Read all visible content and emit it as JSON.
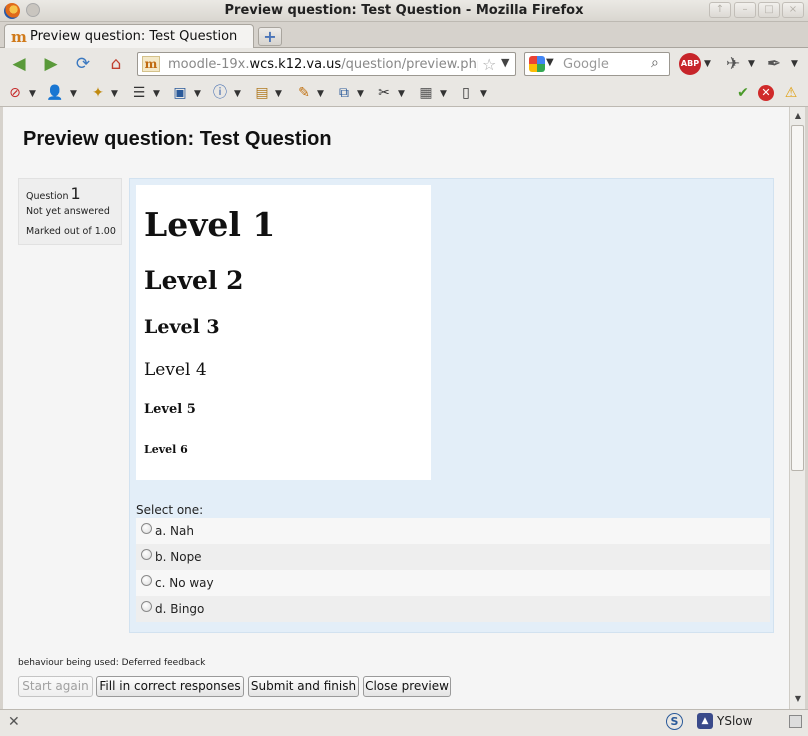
{
  "window": {
    "title": "Preview question: Test Question - Mozilla Firefox",
    "controls": [
      "↑",
      "–",
      "□",
      "×"
    ]
  },
  "tab": {
    "title": "Preview question: Test Question",
    "new_tab": "+"
  },
  "nav": {
    "url_prefix": "moodle-19x.",
    "url_host": "wcs.k12.va.us",
    "url_path": "/question/preview.php?i",
    "url_favicon": "m",
    "search_placeholder": "Google",
    "adblock_label": "ABP"
  },
  "page": {
    "title": "Preview question: Test Question",
    "info": {
      "question_label": "Question",
      "question_number": "1",
      "state": "Not yet answered",
      "marked": "Marked out of 1.00"
    },
    "question_text": {
      "h1": "Level 1",
      "h2": "Level 2",
      "h3": "Level 3",
      "h4": "Level 4",
      "h5": "Level 5",
      "h6": "Level 6"
    },
    "prompt": "Select one:",
    "answers": [
      "a. Nah",
      "b. Nope",
      "c. No way",
      "d. Bingo"
    ],
    "behaviour": "behaviour being used: Deferred feedback",
    "buttons": {
      "start_again": "Start again",
      "fill_correct": "Fill in correct responses",
      "submit_finish": "Submit and finish",
      "close_preview": "Close preview"
    }
  },
  "statusbar": {
    "yslow": "YSlow",
    "s_icon": "S"
  },
  "colors": {
    "formulation_bg": "#e3eef8",
    "info_bg": "#eeeeee",
    "abp_red": "#c7252a"
  }
}
